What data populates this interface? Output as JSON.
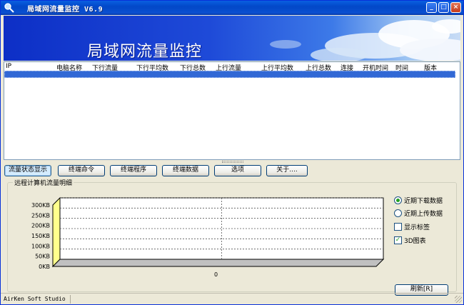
{
  "window": {
    "title": "局域网流量监控 V6.9",
    "buttons": {
      "minimize": "_",
      "maximize": "□",
      "close": "×"
    }
  },
  "banner": {
    "title": "局域网流量监控"
  },
  "listview": {
    "columns": [
      "IP",
      "电脑名称",
      "下行流量",
      "下行平均数",
      "下行总数",
      "上行流量",
      "上行平均数",
      "上行总数",
      "连接",
      "开机时间",
      "时间",
      "版本"
    ]
  },
  "tabs": [
    "流量状态显示",
    "终端命令",
    "终端程序",
    "终端数据",
    "选项",
    "关于...."
  ],
  "group": {
    "title": "远程计算机流量明细"
  },
  "chart_data": {
    "type": "area",
    "y_ticks": [
      "300KB",
      "250KB",
      "200KB",
      "150KB",
      "100KB",
      "50KB",
      "0KB"
    ],
    "ylim": [
      0,
      300
    ],
    "x_ticks": [
      "0"
    ],
    "values": [],
    "grid": true
  },
  "options": {
    "radios": [
      {
        "label": "近期下载数据",
        "checked": true
      },
      {
        "label": "近期上传数据",
        "checked": false
      }
    ],
    "checks": [
      {
        "label": "显示标签",
        "checked": false
      },
      {
        "label": "3D图表",
        "checked": true
      }
    ],
    "refresh_label": "刷新[R]"
  },
  "statusbar": {
    "text": "AirKen Soft Studio"
  }
}
